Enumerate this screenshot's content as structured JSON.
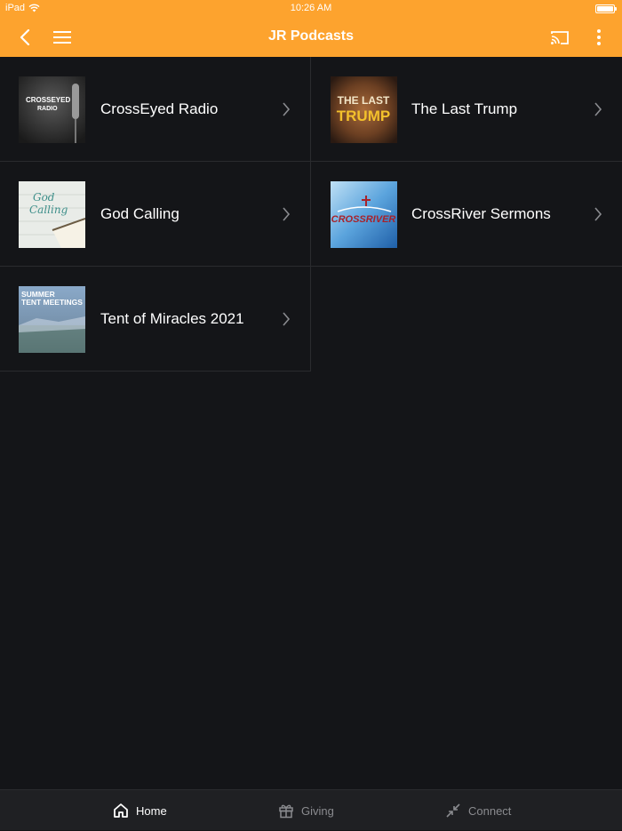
{
  "status_bar": {
    "device": "iPad",
    "time": "10:26 AM"
  },
  "nav": {
    "title": "JR Podcasts"
  },
  "podcasts": [
    {
      "label": "CrossEyed Radio",
      "thumb_text": [
        "CROSSEYED",
        "RADIO"
      ]
    },
    {
      "label": "The Last Trump",
      "thumb_text": [
        "THE LAST",
        "TRUMP"
      ]
    },
    {
      "label": "God Calling",
      "thumb_text": [
        "God",
        "Calling"
      ]
    },
    {
      "label": "CrossRiver Sermons",
      "thumb_text": [
        "CROSSRIVER"
      ]
    },
    {
      "label": "Tent of Miracles 2021",
      "thumb_text": [
        "SUMMER",
        "TENT MEETINGS"
      ]
    }
  ],
  "tabs": {
    "home": "Home",
    "giving": "Giving",
    "connect": "Connect"
  },
  "colors": {
    "accent": "#fda32e",
    "background": "#141518",
    "tab_bar": "#1f2023"
  }
}
